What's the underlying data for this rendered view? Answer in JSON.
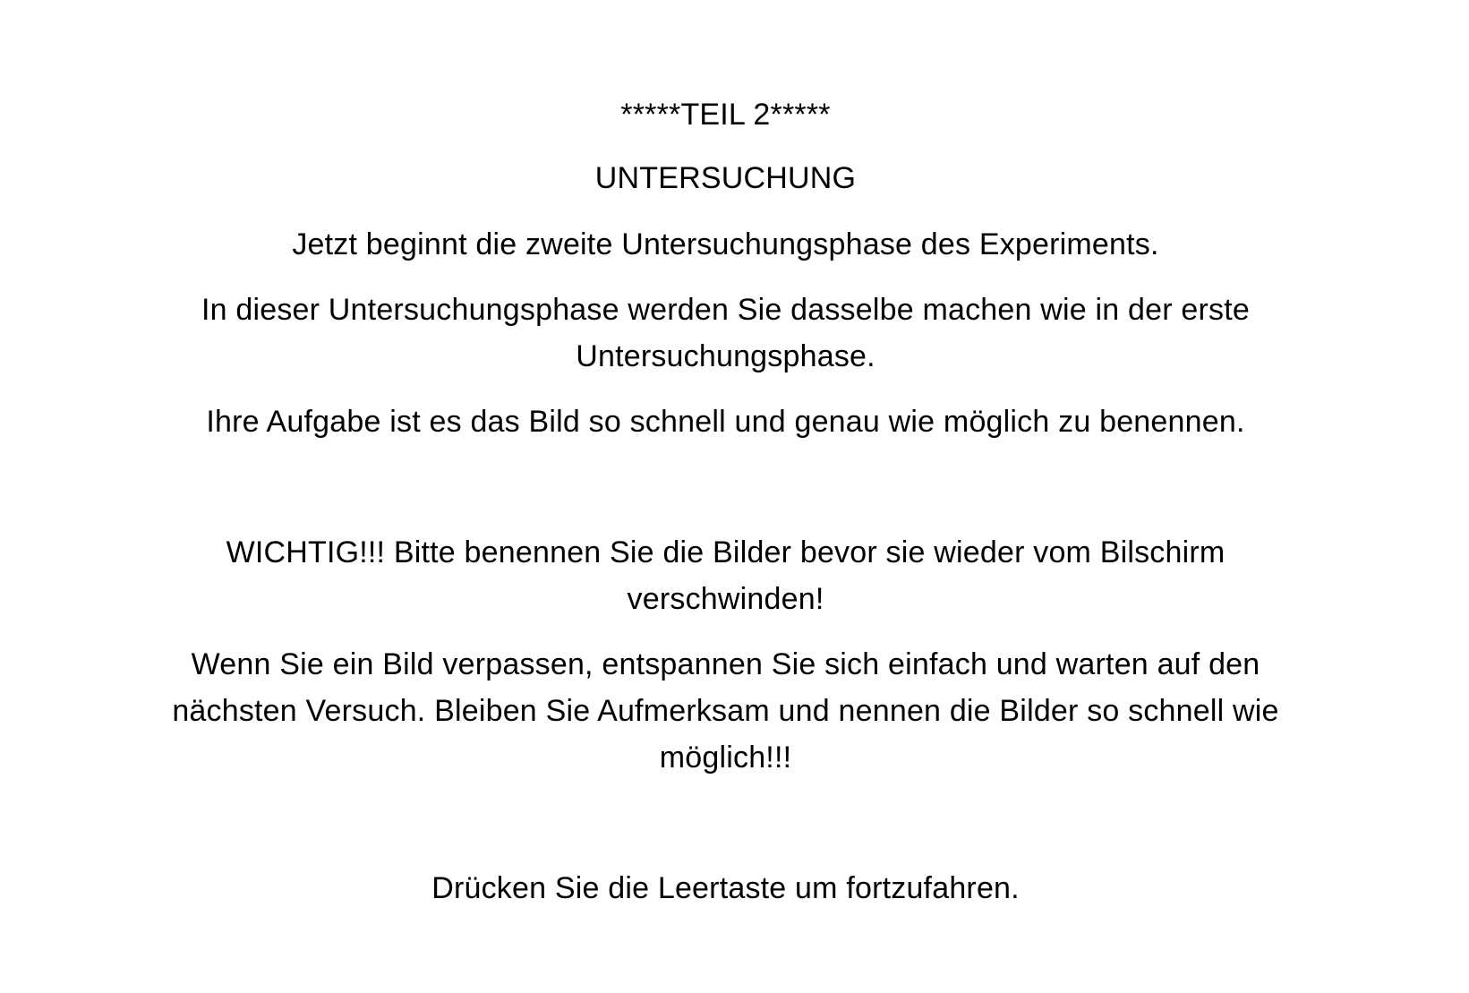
{
  "instructions": {
    "part_title": "*****TEIL 2*****",
    "section_title": "UNTERSUCHUNG",
    "intro": "Jetzt beginnt die zweite Untersuchungsphase des Experiments.",
    "same_task": {
      "line1": "In dieser Untersuchungsphase werden Sie dasselbe machen wie in der erste",
      "line2": "Untersuchungsphase."
    },
    "task": "Ihre Aufgabe ist es das Bild so schnell und genau wie möglich zu benennen.",
    "important": {
      "line1": "WICHTIG!!! Bitte benennen Sie die Bilder bevor sie wieder vom Bilschirm",
      "line2": "verschwinden!"
    },
    "missed": {
      "line1": "Wenn Sie ein Bild verpassen, entspannen Sie sich einfach und warten auf den",
      "line2": "nächsten Versuch. Bleiben Sie Aufmerksam und nennen die Bilder so schnell wie",
      "line3": "möglich!!!"
    },
    "continue_prompt": "Drücken Sie die Leertaste um fortzufahren."
  }
}
